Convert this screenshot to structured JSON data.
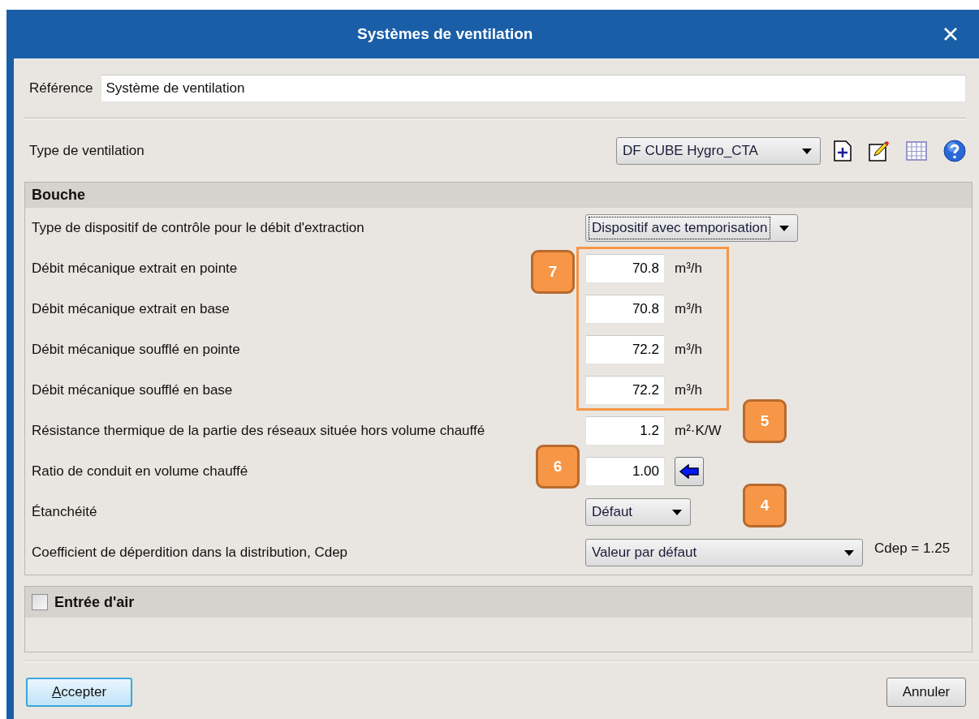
{
  "window": {
    "title": "Systèmes de ventilation"
  },
  "reference": {
    "label": "Référence",
    "value": "Système de ventilation"
  },
  "ventilation_type": {
    "label": "Type de ventilation",
    "value": "DF CUBE Hygro_CTA",
    "focused": false
  },
  "sections": [
    {
      "title": "Bouche",
      "kind": "plain",
      "rows": [
        {
          "kind": "select",
          "label": "Type de dispositif de contrôle pour le débit d'extraction",
          "value": "Dispositif avec temporisation",
          "focused": true
        },
        {
          "kind": "number",
          "label": "Débit mécanique extrait en pointe",
          "value": "70.8",
          "unit": "m³/h"
        },
        {
          "kind": "number",
          "label": "Débit mécanique extrait en base",
          "value": "70.8",
          "unit": "m³/h"
        },
        {
          "kind": "number",
          "label": "Débit mécanique soufflé en pointe",
          "value": "72.2",
          "unit": "m³/h"
        },
        {
          "kind": "number",
          "label": "Débit mécanique soufflé en base",
          "value": "72.2",
          "unit": "m³/h"
        },
        {
          "kind": "number",
          "label": "Résistance thermique de la partie des réseaux située hors volume chauffé",
          "value": "1.2",
          "unit": "m²·K/W"
        },
        {
          "kind": "number_action",
          "label": "Ratio de conduit en volume chauffé",
          "value": "1.00"
        },
        {
          "kind": "select",
          "label": "Étanchéité",
          "value": "Défaut",
          "focused": false
        },
        {
          "kind": "select",
          "label": "Coefficient de déperdition dans la distribution, Cdep",
          "value": "Valeur par défaut",
          "focused": false,
          "note": "Cdep = 1.25"
        }
      ]
    },
    {
      "title": "Entrée d'air",
      "kind": "checkbox",
      "checked": false
    }
  ],
  "buttons": [
    {
      "label": "Accepter",
      "default": true,
      "mnemonic": true
    },
    {
      "label": "Annuler",
      "default": false,
      "mnemonic": false
    }
  ],
  "annotations": [
    {
      "label": "7"
    },
    {
      "label": "6"
    },
    {
      "label": "5"
    },
    {
      "label": "4"
    }
  ]
}
